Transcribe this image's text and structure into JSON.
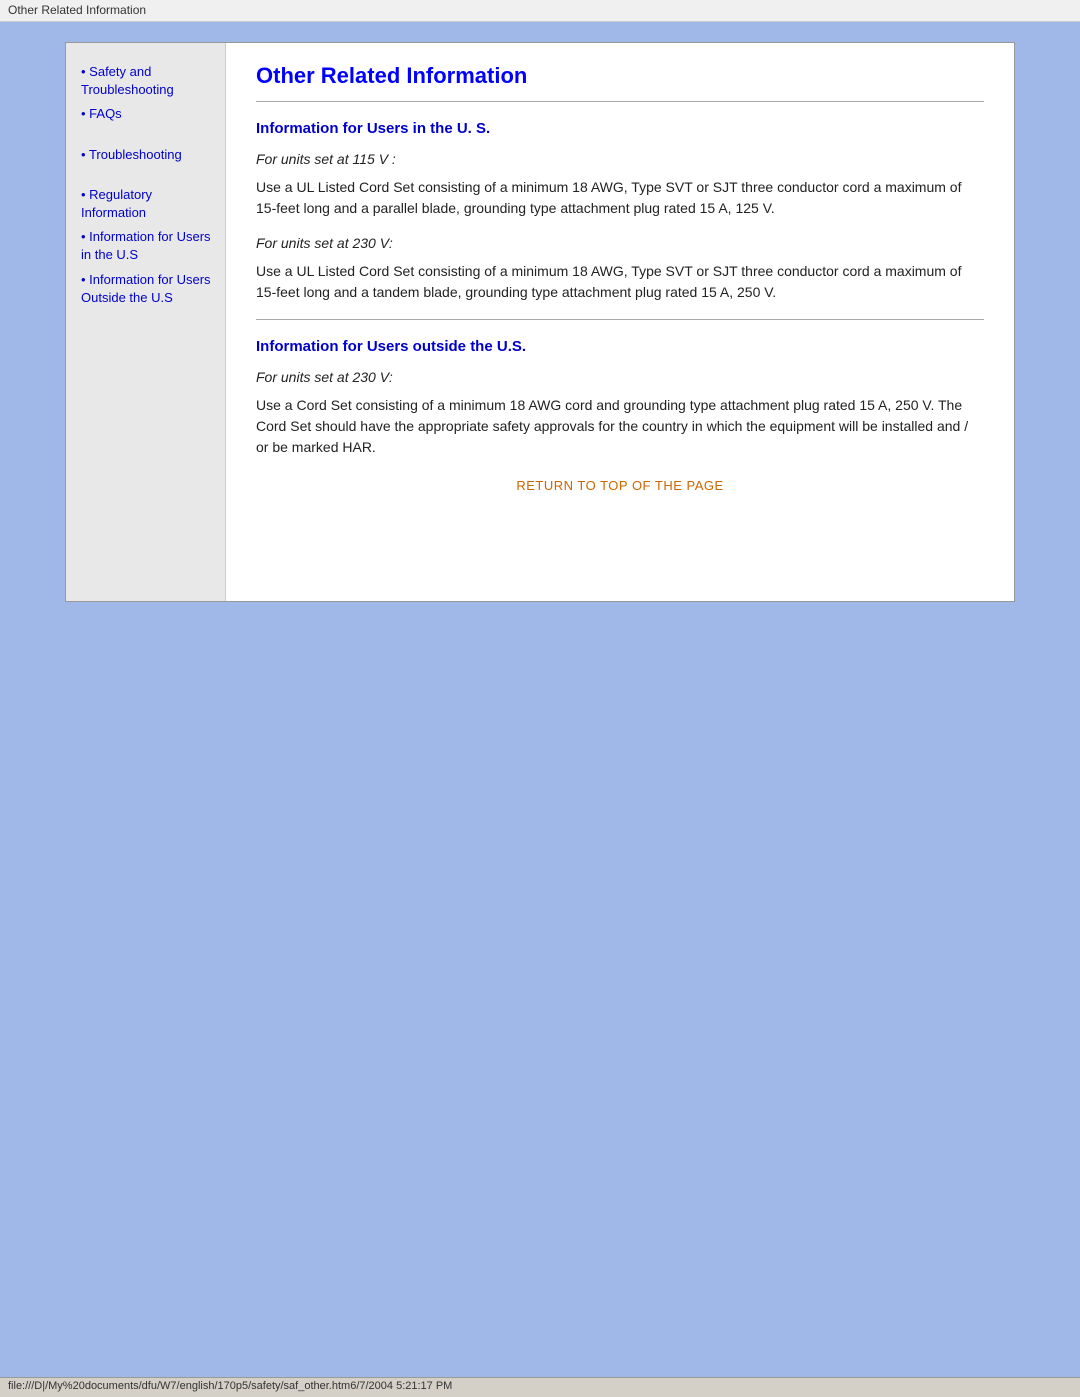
{
  "titlebar": {
    "text": "Other Related Information"
  },
  "sidebar": {
    "items": [
      {
        "id": "safety",
        "label": "Safety and Troubleshooting"
      },
      {
        "id": "faqs",
        "label": "FAQs"
      },
      {
        "id": "troubleshooting",
        "label": "Troubleshooting"
      },
      {
        "id": "regulatory",
        "label": "Regulatory Information"
      },
      {
        "id": "info-us",
        "label": "Information for Users in the U.S"
      },
      {
        "id": "info-outside",
        "label": "Information for Users Outside the U.S"
      }
    ]
  },
  "content": {
    "page_title": "Other Related Information",
    "section1": {
      "title": "Information for Users in the U. S.",
      "block1_label": "For units set at 115 V :",
      "block1_text": "Use a UL Listed Cord Set consisting of a minimum 18 AWG, Type SVT or SJT three conductor cord a maximum of 15-feet long and a parallel blade, grounding type attachment plug rated 15 A, 125 V.",
      "block2_label": "For units set at 230 V:",
      "block2_text": "Use a UL Listed Cord Set consisting of a minimum 18 AWG, Type SVT or SJT three conductor cord a maximum of 15-feet long and a tandem blade, grounding type attachment plug rated 15 A, 250 V."
    },
    "section2": {
      "title": "Information for Users outside the U.S.",
      "block1_label": "For units set at 230 V:",
      "block1_text": "Use a Cord Set consisting of a minimum 18 AWG cord and grounding type attachment plug rated 15 A, 250 V. The Cord Set should have the appropriate safety approvals for the country in which the equipment will be installed and / or be marked HAR."
    },
    "return_link": "RETURN TO TOP OF THE PAGE"
  },
  "statusbar": {
    "text": "file:///D|/My%20documents/dfu/W7/english/170p5/safety/saf_other.htm6/7/2004  5:21:17 PM"
  }
}
